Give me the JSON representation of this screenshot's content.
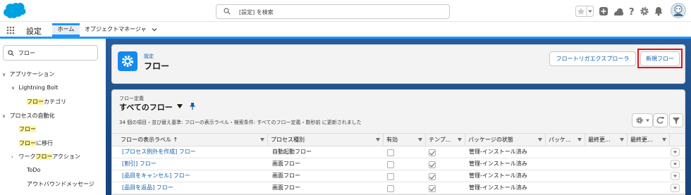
{
  "topbar": {
    "search_placeholder": "[設定] を検索",
    "icons": [
      "favorites-star-icon",
      "favorites-list-icon",
      "global-add-icon",
      "trailhead-icon",
      "help-icon",
      "setup-gear-icon",
      "notifications-bell-icon",
      "user-avatar"
    ]
  },
  "nav": {
    "app_name": "設定",
    "tabs": [
      {
        "label": "ホーム"
      },
      {
        "label": "オブジェクトマネージャ"
      }
    ]
  },
  "sidebar": {
    "search_value": "フロー",
    "items": [
      {
        "label": "アプリケーション"
      },
      {
        "label": "Lightning Bolt"
      },
      {
        "label": "フロー",
        "suffix": "カテゴリ"
      },
      {
        "label": "プロセスの自動化"
      },
      {
        "label": "フロー"
      },
      {
        "label": "フロー",
        "suffix": "に移行"
      },
      {
        "label": "ワーク",
        "mid": "フロー",
        "suffix": "アクション"
      },
      {
        "label": "ToDo"
      },
      {
        "label": "アウトバウンドメッセージ"
      }
    ]
  },
  "header": {
    "breadcrumb": "設定",
    "title": "フロー",
    "trigger_button": "フロートリガエクスプローラ",
    "new_button": "新規フロー"
  },
  "listview": {
    "object_label": "フロー定義",
    "name": "すべてのフロー",
    "info": "34 個の項目・並び替え基準: フローの表示ラベル・検索条件: すべてのフロー定義・数秒前 に更新されました",
    "columns": [
      {
        "label": "フローの表示ラベル ↑"
      },
      {
        "label": "プロセス種別"
      },
      {
        "label": "有効"
      },
      {
        "label": "テンプ..."
      },
      {
        "label": "パッケージの状態"
      },
      {
        "label": "パッケ..."
      },
      {
        "label": "最終更..."
      },
      {
        "label": "最終更..."
      }
    ],
    "rows": [
      {
        "label": "[プロセス例外を作成] フロー",
        "type": "自動起動フロー",
        "active": false,
        "template": true,
        "package": "管理-インストール済み"
      },
      {
        "label": "[割引] フロー",
        "type": "画面フロー",
        "active": false,
        "template": true,
        "package": "管理-インストール済み"
      },
      {
        "label": "[品目をキャンセル] フロー",
        "type": "画面フロー",
        "active": false,
        "template": true,
        "package": "管理-インストール済み"
      },
      {
        "label": "[品目を返品] フロー",
        "type": "画面フロー",
        "active": false,
        "template": true,
        "package": "管理-インストール済み"
      }
    ]
  },
  "colors": {
    "brand": "#1b96ff",
    "link": "#0b5cab",
    "highlight": "#fff59d",
    "alert_outline": "#e3121c"
  }
}
